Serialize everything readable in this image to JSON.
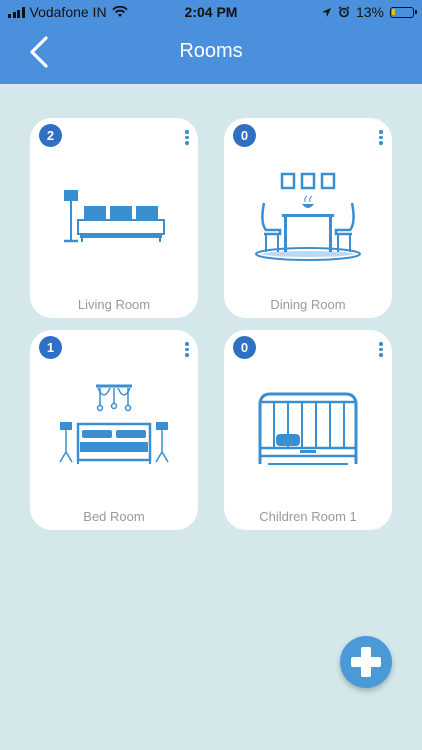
{
  "status_bar": {
    "carrier": "Vodafone IN",
    "time": "2:04 PM",
    "battery": "13%"
  },
  "header": {
    "title": "Rooms",
    "back_icon": "chevron-left-icon"
  },
  "rooms": [
    {
      "name": "Living Room",
      "count": "2",
      "illustration": "living-room-icon"
    },
    {
      "name": "Dining Room",
      "count": "0",
      "illustration": "dining-room-icon"
    },
    {
      "name": "Bed Room",
      "count": "1",
      "illustration": "bed-room-icon"
    },
    {
      "name": "Children Room 1",
      "count": "0",
      "illustration": "crib-icon"
    }
  ],
  "fab": {
    "icon": "plus-icon"
  },
  "colors": {
    "header": "#4a90dd",
    "background": "#d4e8ec",
    "accent": "#3a8fd0",
    "badge": "#2f6fc4"
  }
}
